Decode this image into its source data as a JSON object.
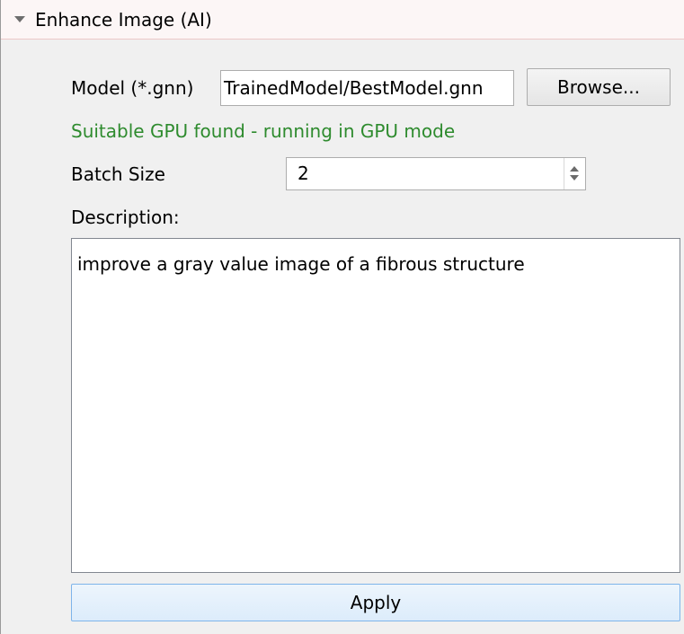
{
  "section": {
    "title": "Enhance Image (AI)",
    "expanded": true
  },
  "model": {
    "label": "Model (*.gnn)",
    "value": "TrainedModel/BestModel.gnn",
    "browse_label": "Browse..."
  },
  "status": {
    "text": "Suitable GPU found - running in GPU mode",
    "color": "#2e8b2e"
  },
  "batch": {
    "label": "Batch Size",
    "value": "2"
  },
  "description": {
    "label": "Description:",
    "text": "improve a gray value image of a fibrous structure"
  },
  "apply": {
    "label": "Apply"
  },
  "colors": {
    "panel_bg": "#f0f0f0",
    "header_bg": "#fcf6f6",
    "apply_border": "#7eb4ea"
  }
}
